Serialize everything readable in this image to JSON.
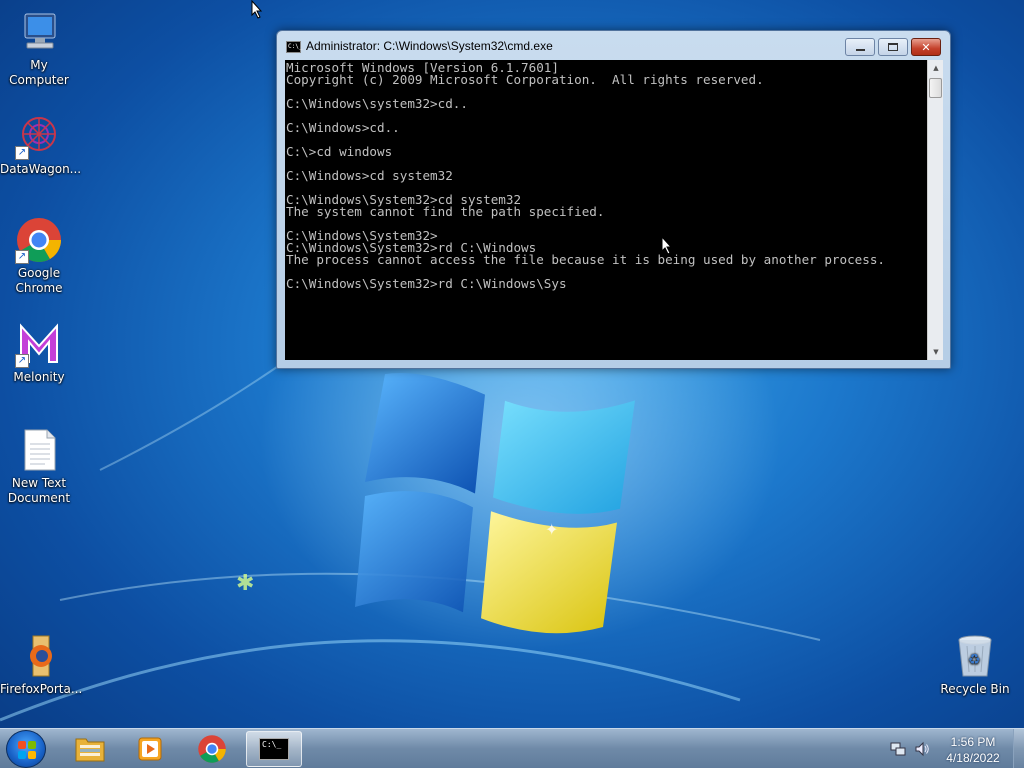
{
  "desktop": {
    "icons": [
      {
        "label": "My Computer"
      },
      {
        "label": "DataWagon..."
      },
      {
        "label": "Google Chrome"
      },
      {
        "label": "Melonity"
      },
      {
        "label": "New Text Document"
      },
      {
        "label": "FirefoxPorta..."
      },
      {
        "label": "Recycle Bin"
      }
    ]
  },
  "cmd_window": {
    "title": "Administrator: C:\\Windows\\System32\\cmd.exe",
    "icon_text": "C:\\_",
    "lines": [
      "Microsoft Windows [Version 6.1.7601]",
      "Copyright (c) 2009 Microsoft Corporation.  All rights reserved.",
      "",
      "C:\\Windows\\system32>cd..",
      "",
      "C:\\Windows>cd..",
      "",
      "C:\\>cd windows",
      "",
      "C:\\Windows>cd system32",
      "",
      "C:\\Windows\\System32>cd system32",
      "The system cannot find the path specified.",
      "",
      "C:\\Windows\\System32>",
      "C:\\Windows\\System32>rd C:\\Windows",
      "The process cannot access the file because it is being used by another process.",
      "",
      "C:\\Windows\\System32>rd C:\\Windows\\Sys"
    ]
  },
  "taskbar": {
    "items": [
      {
        "name": "windows-explorer"
      },
      {
        "name": "media-player"
      },
      {
        "name": "google-chrome"
      },
      {
        "name": "command-prompt",
        "icon_text": "C:\\_"
      }
    ],
    "clock": {
      "time": "1:56 PM",
      "date": "4/18/2022"
    }
  }
}
